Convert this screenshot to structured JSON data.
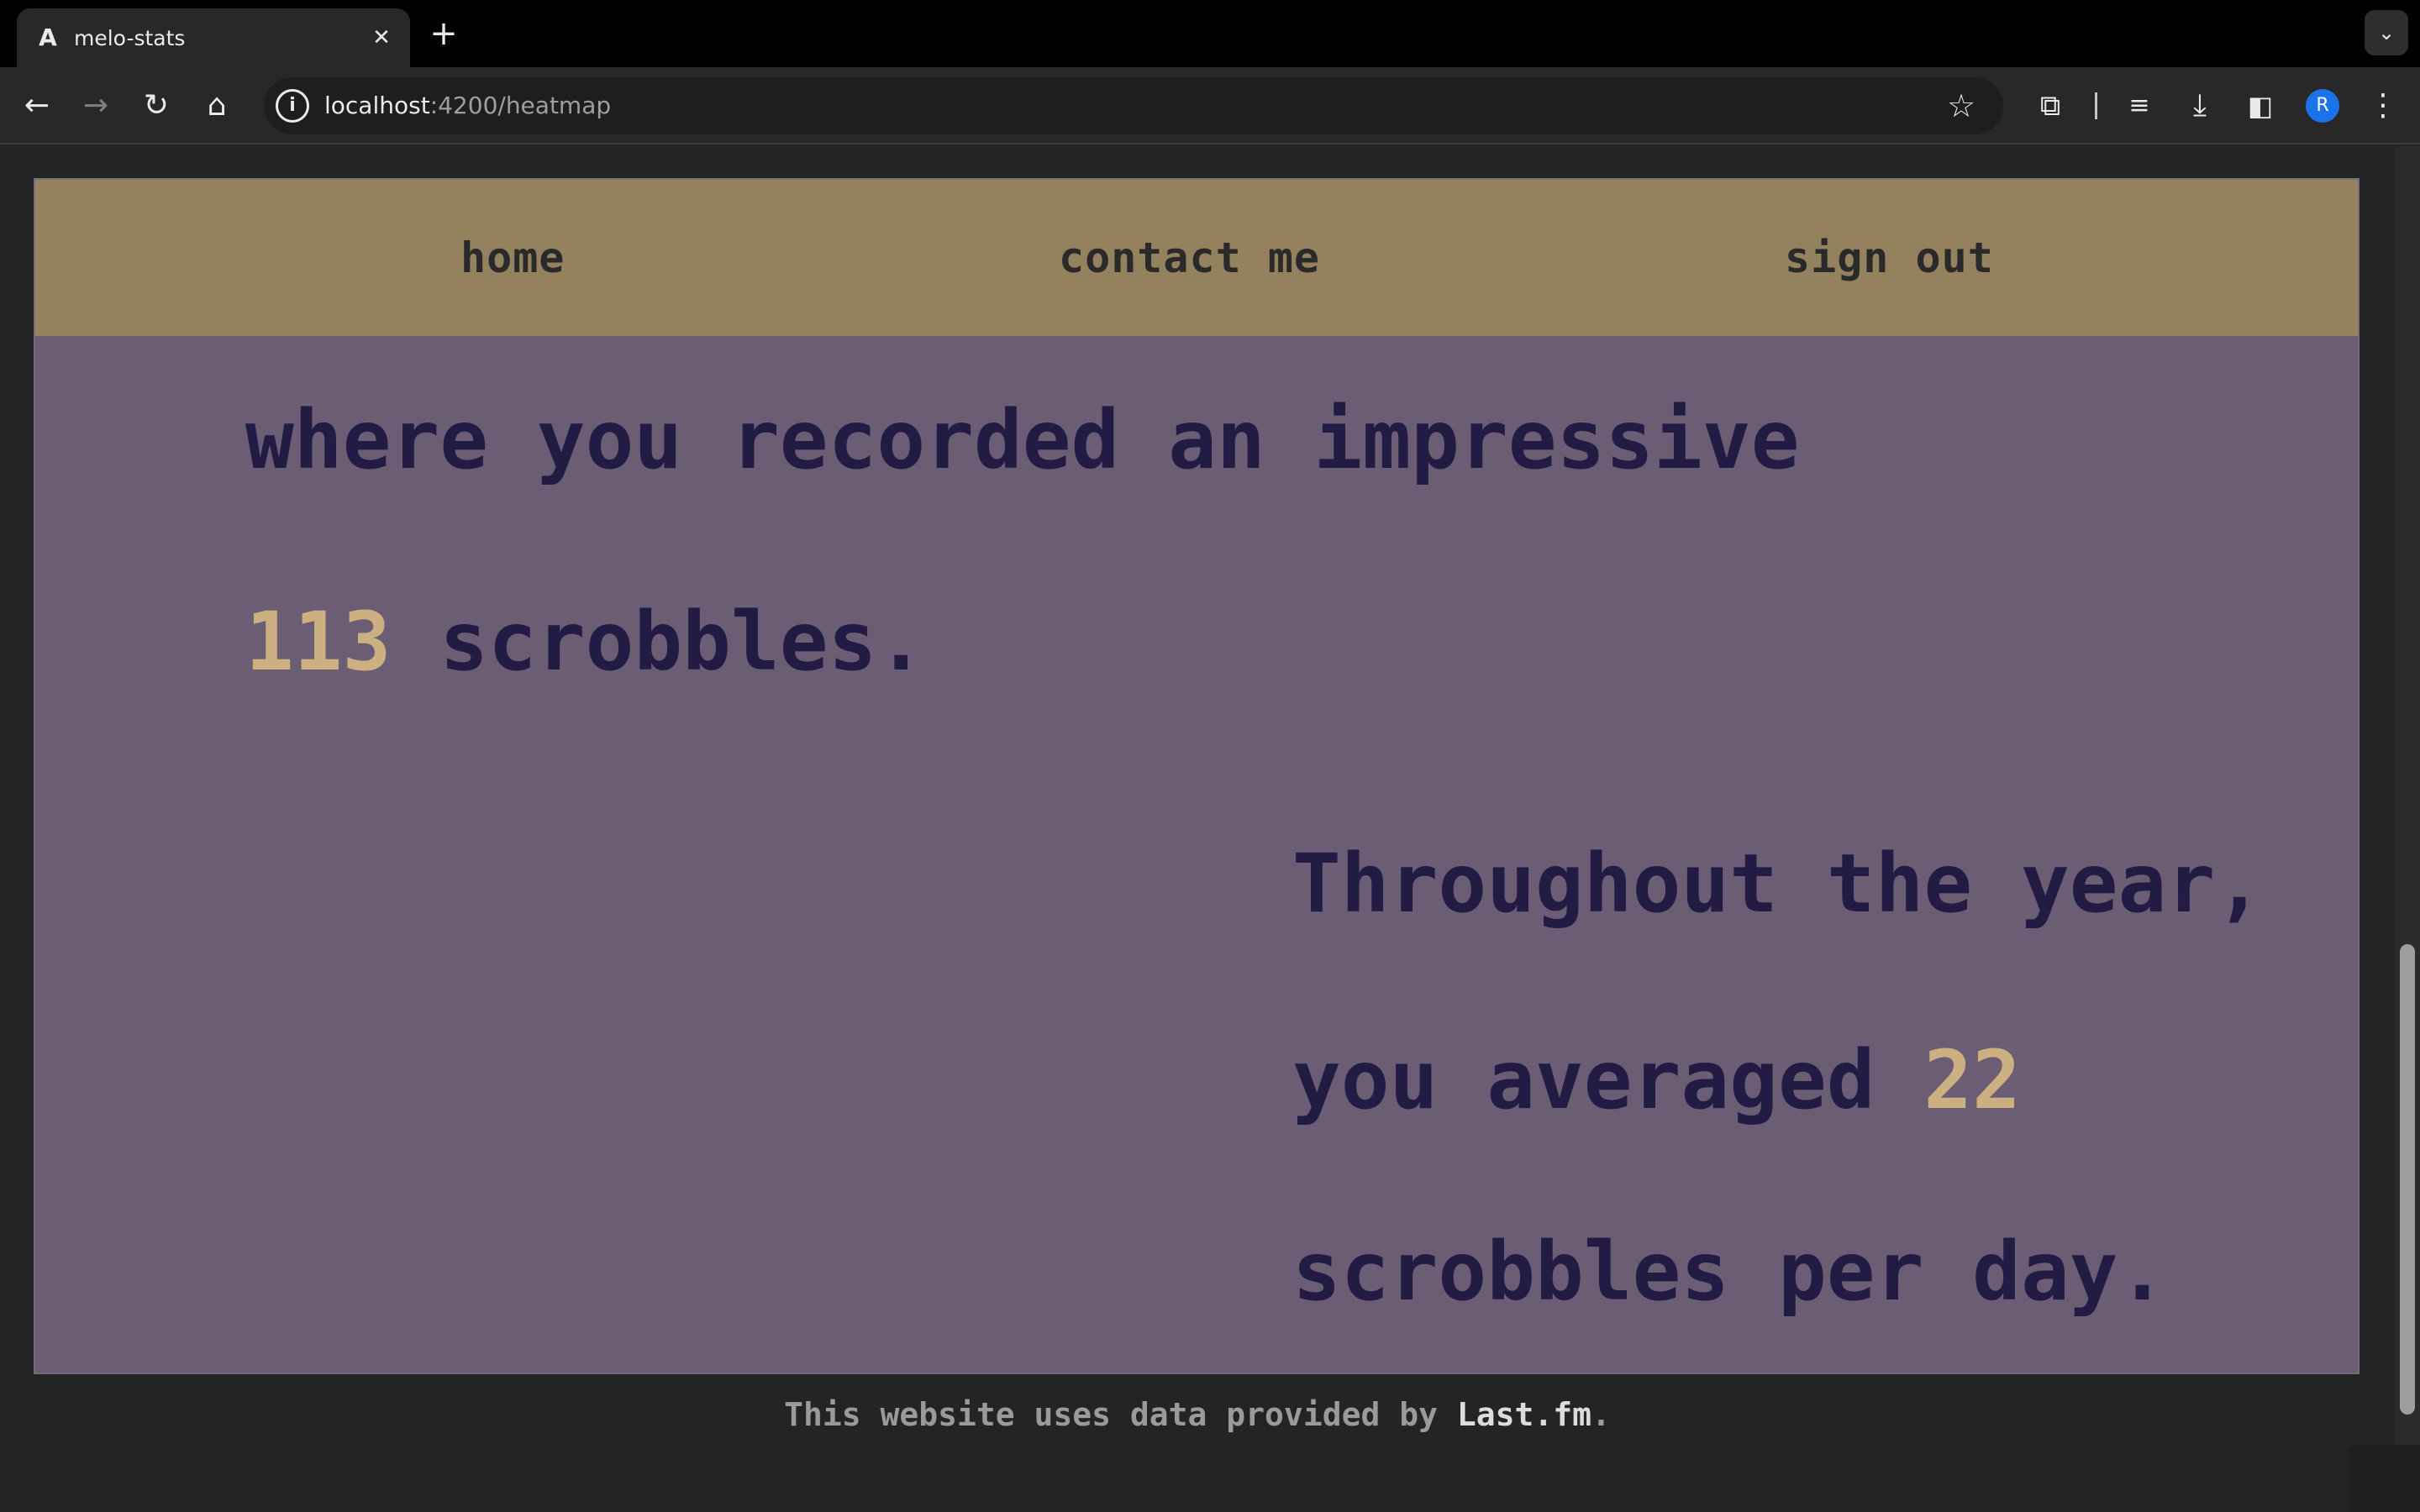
{
  "browser": {
    "tab_title": "melo-stats",
    "tab_close": "✕",
    "new_tab": "+",
    "url_host": "localhost",
    "url_path": ":4200/heatmap",
    "profile_initial": "R"
  },
  "nav": {
    "home": "home",
    "contact": "contact me",
    "signout": "sign out"
  },
  "stats": {
    "line1": "where you recorded an impressive",
    "total_scrobbles": "113",
    "line2_suffix": " scrobbles.",
    "line3": "Throughout the year,",
    "line4_prefix": "you averaged ",
    "avg_per_day": "22",
    "line5": "scrobbles per day."
  },
  "footer": {
    "text": "This website uses data provided by ",
    "brand": "Last.fm",
    "end": "."
  },
  "colors": {
    "nav_bg": "#94825e",
    "content_bg": "#6b5d74",
    "text": "#221c45",
    "highlight": "#ccb082",
    "page_bg": "#242424"
  }
}
